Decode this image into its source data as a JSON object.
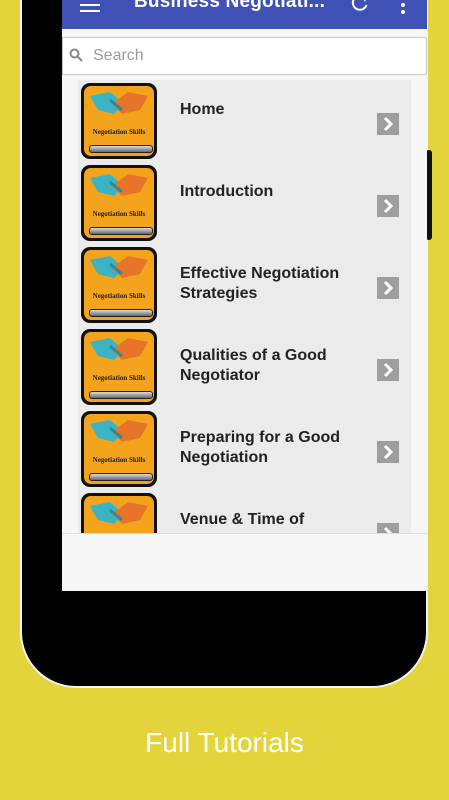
{
  "app_bar": {
    "title": "Business Negotiati...",
    "menu_icon": "hamburger-menu-icon",
    "refresh_icon": "refresh-icon",
    "more_icon": "more-vert-icon",
    "color": "#3f51b5"
  },
  "search": {
    "placeholder": "Search",
    "value": "",
    "icon": "search-icon"
  },
  "list": {
    "thumbnail_text": "Negotiation Skills",
    "items": [
      {
        "label": "Home"
      },
      {
        "label": "Introduction"
      },
      {
        "label": "Effective Negotiation Strategies"
      },
      {
        "label": "Qualities of a Good Negotiator"
      },
      {
        "label": "Preparing for a Good Negotiation"
      },
      {
        "label": "Venue & Time of"
      }
    ]
  },
  "caption": "Full Tutorials",
  "colors": {
    "background": "#e4d43c",
    "thumbnail": "#f3a41c",
    "arrow_button": "#9e9e9e"
  }
}
